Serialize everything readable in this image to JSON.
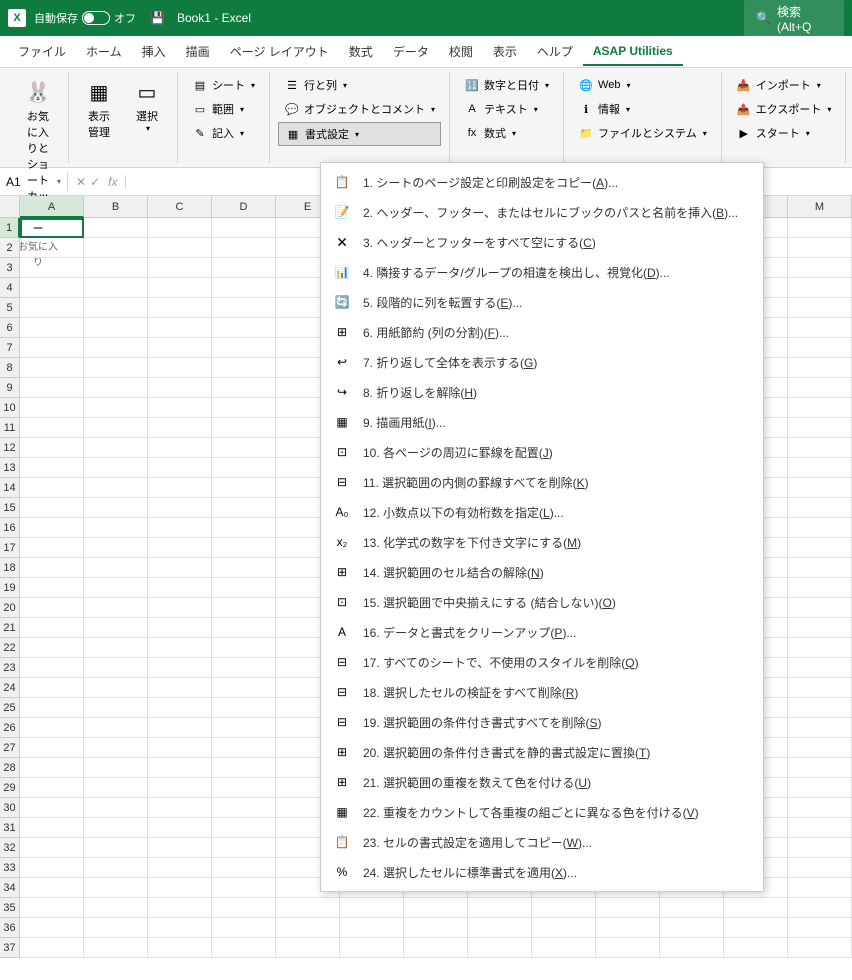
{
  "titleBar": {
    "autosave": "自動保存",
    "autosaveState": "オフ",
    "title": "Book1 - Excel",
    "searchPlaceholder": "検索 (Alt+Q"
  },
  "tabs": [
    {
      "id": "file",
      "label": "ファイル"
    },
    {
      "id": "home",
      "label": "ホーム"
    },
    {
      "id": "insert",
      "label": "挿入"
    },
    {
      "id": "draw",
      "label": "描画"
    },
    {
      "id": "pagelayout",
      "label": "ページ レイアウト"
    },
    {
      "id": "formulas",
      "label": "数式"
    },
    {
      "id": "data",
      "label": "データ"
    },
    {
      "id": "review",
      "label": "校閲"
    },
    {
      "id": "view",
      "label": "表示"
    },
    {
      "id": "help",
      "label": "ヘルプ"
    },
    {
      "id": "asap",
      "label": "ASAP Utilities",
      "active": true
    }
  ],
  "ribbon": {
    "favorites": {
      "label": "お気に入りとショートカットキー",
      "group": "お気に入り"
    },
    "viewmgr": "表示管理",
    "select": "選択",
    "col1": [
      "シート",
      "範囲",
      "記入"
    ],
    "col2": [
      "行と列",
      "オブジェクトとコメント",
      "書式設定"
    ],
    "col3": [
      "数字と日付",
      "テキスト",
      "数式"
    ],
    "col4": [
      "Web",
      "情報",
      "ファイルとシステム"
    ],
    "col5": [
      "インポート",
      "エクスポート",
      "スタート"
    ]
  },
  "nameBox": "A1",
  "columns": [
    "A",
    "B",
    "C",
    "D",
    "E",
    "",
    "",
    "",
    "",
    "",
    "",
    "",
    "M"
  ],
  "rowCount": 37,
  "activeCell": {
    "row": 0,
    "col": 0
  },
  "menu": [
    {
      "num": "1",
      "text": "シートのページ設定と印刷設定をコピー",
      "key": "A",
      "suffix": "..."
    },
    {
      "num": "2",
      "text": "ヘッダー、フッター、またはセルにブックのパスと名前を挿入",
      "key": "B",
      "suffix": "..."
    },
    {
      "num": "3",
      "text": "ヘッダーとフッターをすべて空にする",
      "key": "C",
      "suffix": ""
    },
    {
      "num": "4",
      "text": "隣接するデータ/グループの相違を検出し、視覚化",
      "key": "D",
      "suffix": "..."
    },
    {
      "num": "5",
      "text": "段階的に列を転置する",
      "key": "E",
      "suffix": "..."
    },
    {
      "num": "6",
      "text": "用紙節約 (列の分割)",
      "key": "F",
      "suffix": "..."
    },
    {
      "num": "7",
      "text": "折り返して全体を表示する",
      "key": "G",
      "suffix": ""
    },
    {
      "num": "8",
      "text": "折り返しを解除",
      "key": "H",
      "suffix": ""
    },
    {
      "num": "9",
      "text": "描画用紙",
      "key": "I",
      "suffix": "..."
    },
    {
      "num": "10",
      "text": "各ページの周辺に罫線を配置",
      "key": "J",
      "suffix": ""
    },
    {
      "num": "11",
      "text": "選択範囲の内側の罫線すべてを削除",
      "key": "K",
      "suffix": ""
    },
    {
      "num": "12",
      "text": "小数点以下の有効桁数を指定",
      "key": "L",
      "suffix": "..."
    },
    {
      "num": "13",
      "text": "化学式の数字を下付き文字にする",
      "key": "M",
      "suffix": ""
    },
    {
      "num": "14",
      "text": "選択範囲のセル結合の解除",
      "key": "N",
      "suffix": ""
    },
    {
      "num": "15",
      "text": "選択範囲で中央揃えにする (結合しない)",
      "key": "O",
      "suffix": ""
    },
    {
      "num": "16",
      "text": "データと書式をクリーンアップ",
      "key": "P",
      "suffix": "..."
    },
    {
      "num": "17",
      "text": "すべてのシートで、不使用のスタイルを削除",
      "key": "Q",
      "suffix": ""
    },
    {
      "num": "18",
      "text": "選択したセルの検証をすべて削除",
      "key": "R",
      "suffix": ""
    },
    {
      "num": "19",
      "text": "選択範囲の条件付き書式すべてを削除",
      "key": "S",
      "suffix": ""
    },
    {
      "num": "20",
      "text": "選択範囲の条件付き書式を静的書式設定に置換",
      "key": "T",
      "suffix": ""
    },
    {
      "num": "21",
      "text": "選択範囲の重複を数えて色を付ける",
      "key": "U",
      "suffix": ""
    },
    {
      "num": "22",
      "text": "重複をカウントして各重複の組ごとに異なる色を付ける",
      "key": "V",
      "suffix": ""
    },
    {
      "num": "23",
      "text": "セルの書式設定を適用してコピー",
      "key": "W",
      "suffix": "..."
    },
    {
      "num": "24",
      "text": "選択したセルに標準書式を適用",
      "key": "X",
      "suffix": "..."
    }
  ],
  "menuIcons": [
    "📋",
    "📝",
    "🗙",
    "📊",
    "🔄",
    "⊞",
    "↩",
    "↪",
    "▦",
    "⊡",
    "⊟",
    "A₀",
    "x₂",
    "⊞",
    "⊡",
    "A",
    "⊟",
    "⊟",
    "⊟",
    "⊞",
    "⊞",
    "▦",
    "📋",
    "%"
  ]
}
